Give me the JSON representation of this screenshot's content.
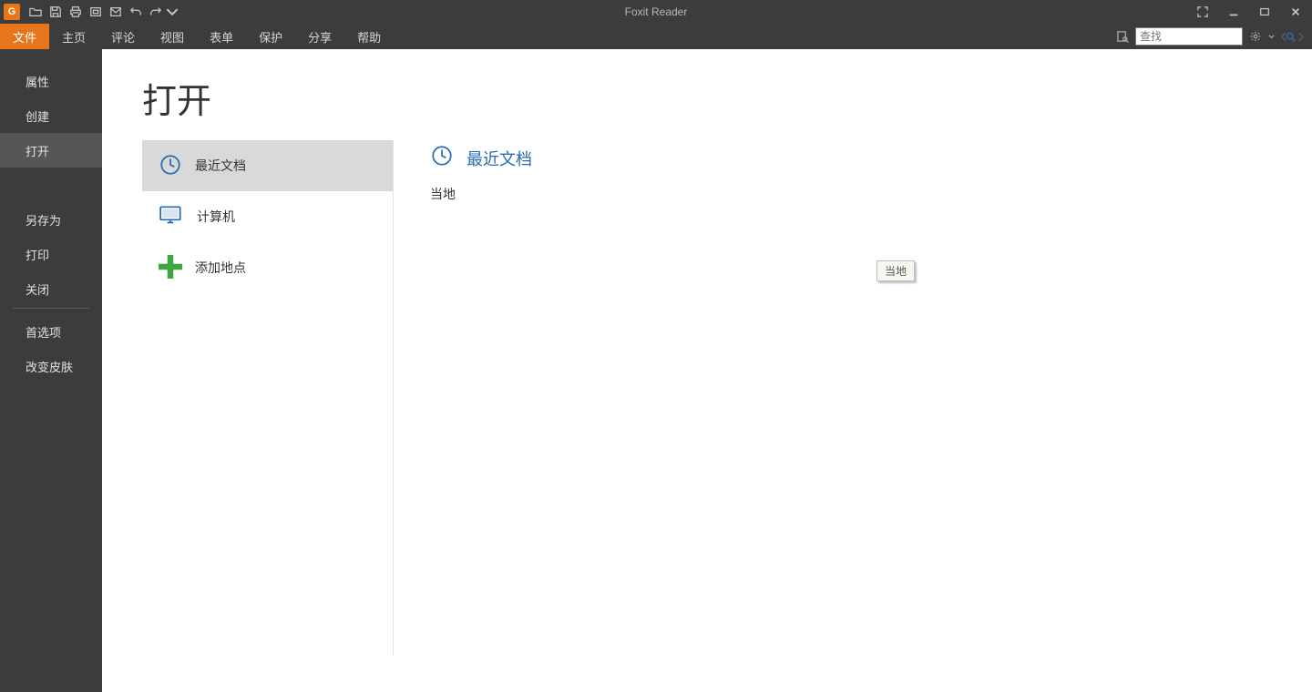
{
  "app": {
    "title": "Foxit Reader"
  },
  "ribbon": {
    "file": "文件",
    "tabs": [
      "主页",
      "评论",
      "视图",
      "表单",
      "保护",
      "分享",
      "帮助"
    ],
    "search_placeholder": "查找"
  },
  "sidebar": {
    "items": [
      {
        "label": "属性"
      },
      {
        "label": "创建"
      },
      {
        "label": "打开",
        "selected": true
      },
      {
        "type": "gap"
      },
      {
        "label": "另存为"
      },
      {
        "label": "打印"
      },
      {
        "label": "关闭"
      },
      {
        "type": "divider"
      },
      {
        "label": "首选项"
      },
      {
        "label": "改变皮肤"
      }
    ]
  },
  "backstage": {
    "heading": "打开",
    "places": [
      {
        "label": "最近文档",
        "icon": "clock",
        "selected": true
      },
      {
        "label": "计算机",
        "icon": "computer"
      },
      {
        "label": "添加地点",
        "icon": "plus"
      }
    ],
    "detail": {
      "header": "最近文档",
      "location": "当地"
    },
    "tooltip": "当地"
  }
}
